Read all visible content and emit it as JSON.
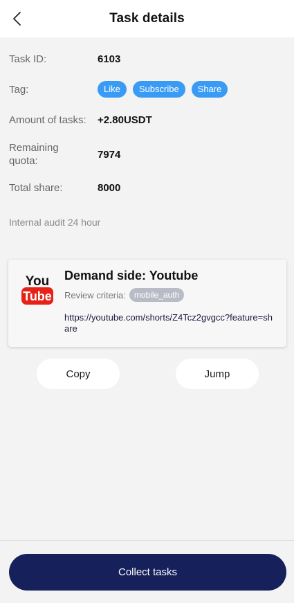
{
  "header": {
    "title": "Task details",
    "back_icon": "chevron-left-icon"
  },
  "details": {
    "task_id_label": "Task ID:",
    "task_id": "6103",
    "tag_label": "Tag:",
    "tags": [
      "Like",
      "Subscribe",
      "Share"
    ],
    "amount_label": "Amount of tasks:",
    "amount": "+2.80USDT",
    "remaining_label": "Remaining quota:",
    "remaining": "7974",
    "total_label": "Total share:",
    "total": "8000",
    "audit": "Internal audit 24 hour"
  },
  "card": {
    "logo_top": "You",
    "logo_bottom": "Tube",
    "title": "Demand side: Youtube",
    "criteria_label": "Review criteria:",
    "criteria_badge": "mobile_auth",
    "link": "https://youtube.com/shorts/Z4Tcz2gvgcc?feature=share"
  },
  "actions": {
    "copy": "Copy",
    "jump": "Jump"
  },
  "footer": {
    "collect": "Collect tasks"
  },
  "colors": {
    "tag": "#3a9bf5",
    "primary": "#16205a",
    "youtube_red": "#e62117"
  }
}
